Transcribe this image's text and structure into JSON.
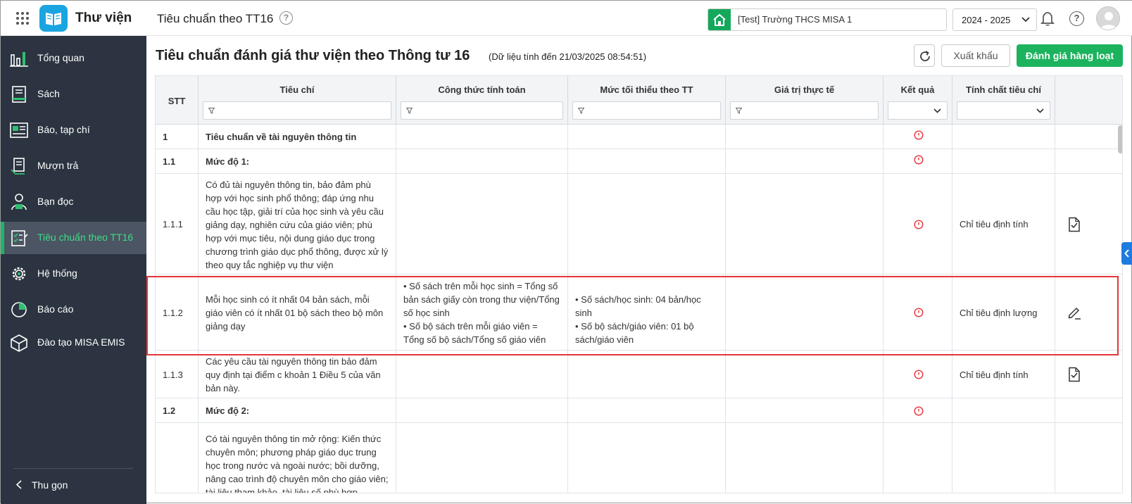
{
  "app": {
    "name": "Thư viện",
    "page_title": "Tiêu chuẩn theo TT16"
  },
  "header": {
    "school": "[Test] Trường THCS MISA 1",
    "year": "2024 - 2025"
  },
  "sidebar": {
    "items": [
      {
        "label": "Tổng quan",
        "icon": "chart-bars-icon"
      },
      {
        "label": "Sách",
        "icon": "book-icon"
      },
      {
        "label": "Báo, tạp chí",
        "icon": "newspaper-icon"
      },
      {
        "label": "Mượn trả",
        "icon": "borrow-return-icon"
      },
      {
        "label": "Bạn đọc",
        "icon": "reader-icon"
      },
      {
        "label": "Tiêu chuẩn theo TT16",
        "icon": "checklist-icon",
        "active": true
      },
      {
        "label": "Hệ thống",
        "icon": "gear-icon"
      },
      {
        "label": "Báo cáo",
        "icon": "pie-chart-icon"
      },
      {
        "label": "Đào tạo MISA EMIS",
        "icon": "cube-icon"
      }
    ],
    "collapse_label": "Thu gọn"
  },
  "main": {
    "title": "Tiêu chuẩn đánh giá thư viện theo Thông tư 16",
    "subtitle": "(Dữ liệu tính đến 21/03/2025 08:54:51)",
    "export_label": "Xuất khẩu",
    "bulk_label": "Đánh giá hàng loạt"
  },
  "table": {
    "columns": [
      "STT",
      "Tiêu chí",
      "Công thức tính toán",
      "Mức tối thiểu theo TT",
      "Giá trị thực tế",
      "Kết quả",
      "Tính chất tiêu chí"
    ],
    "rows": [
      {
        "stt": "1",
        "criteria": "Tiêu chuẩn về tài nguyên thông tin",
        "bold": true,
        "formula": "",
        "minimum": "",
        "actual": "",
        "nature": "",
        "action": ""
      },
      {
        "stt": "1.1",
        "criteria": "Mức độ 1:",
        "bold": true,
        "formula": "",
        "minimum": "",
        "actual": "",
        "nature": "",
        "action": ""
      },
      {
        "stt": "1.1.1",
        "criteria": "Có đủ tài nguyên thông tin, bảo đảm phù hợp với học sinh phổ thông; đáp ứng nhu cầu học tập, giải trí của học sinh và yêu cầu giảng dạy, nghiên cứu của giáo viên; phù hợp với mục tiêu, nội dung giáo dục trong chương trình giáo dục phổ thông, được xử lý theo quy tắc nghiệp vụ thư viện",
        "bold": false,
        "formula": "",
        "minimum": "",
        "actual": "",
        "nature": "Chỉ tiêu định tính",
        "action": "check-document-icon"
      },
      {
        "stt": "1.1.2",
        "criteria": "Mỗi học sinh có ít nhất 04 bản sách, mỗi giáo viên có ít nhất 01 bộ sách theo bộ môn giảng dạy",
        "bold": false,
        "formula": "• Số sách trên mỗi học sinh = Tổng số bản sách giấy còn trong thư viện/Tổng số học sinh\n• Số bộ sách trên mỗi giáo viên = Tổng số bộ sách/Tổng số giáo viên",
        "minimum": "• Số sách/học sinh: 04 bản/học sinh\n• Số bộ sách/giáo viên: 01 bộ sách/giáo viên",
        "actual": "",
        "nature": "Chỉ tiêu định lượng",
        "action": "edit-icon"
      },
      {
        "stt": "1.1.3",
        "criteria": "Các yêu cầu tài nguyên thông tin bảo đảm quy định tại điểm c khoản 1 Điều 5 của văn bản này.",
        "bold": false,
        "formula": "",
        "minimum": "",
        "actual": "",
        "nature": "Chỉ tiêu định tính",
        "action": "check-document-icon"
      },
      {
        "stt": "1.2",
        "criteria": "Mức độ 2:",
        "bold": true,
        "formula": "",
        "minimum": "",
        "actual": "",
        "nature": "",
        "action": ""
      },
      {
        "stt": "",
        "criteria": "Có tài nguyên thông tin mở rộng: Kiến thức chuyên môn; phương pháp giáo dục trung học trong nước và ngoài nước; bồi dưỡng, nâng cao trình độ chuyên môn cho giáo viên; tài liệu tham khảo, tài liệu số phù hợp",
        "bold": false,
        "formula": "",
        "minimum": "",
        "actual": "",
        "nature": "",
        "action": ""
      }
    ]
  },
  "colors": {
    "accent": "#1cb35e",
    "sidebar": "#2b3440",
    "highlight": "#e5343a",
    "status": "#e5343a"
  }
}
